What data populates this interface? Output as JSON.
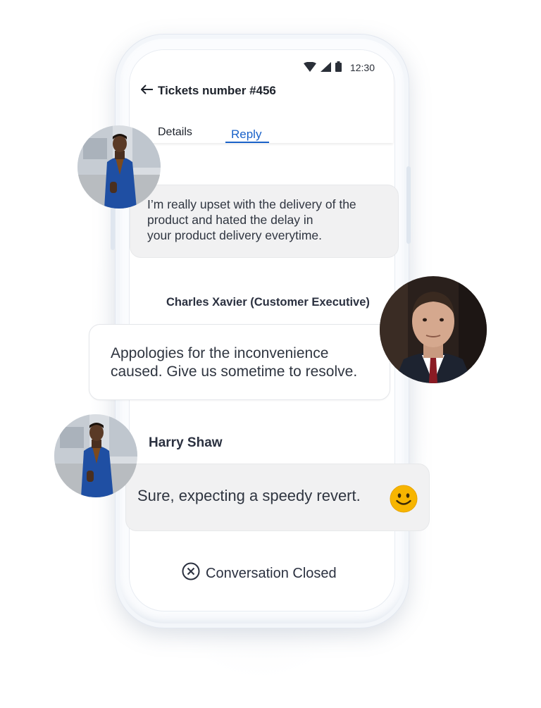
{
  "status_bar": {
    "time": "12:30",
    "wifi_icon": "wifi-icon",
    "signal_icon": "signal-icon",
    "battery_icon": "battery-icon"
  },
  "header": {
    "back_icon": "arrow-left-icon",
    "title": "Tickets number #456"
  },
  "tabs": [
    {
      "label": "Details",
      "active": false
    },
    {
      "label": "Reply",
      "active": true
    }
  ],
  "messages": [
    {
      "sender": "",
      "avatar_icon": "customer-avatar",
      "lines": [
        "I’m really upset with the delivery of the",
        "product and hated the delay in",
        "your product delivery everytime."
      ]
    },
    {
      "sender": "Charles Xavier (Customer Executive)",
      "avatar_icon": "executive-avatar",
      "lines": [
        "Appologies for the inconvenience",
        "caused. Give us sometime to resolve."
      ]
    },
    {
      "sender": "Harry Shaw",
      "avatar_icon": "customer-avatar",
      "lines": [
        "Sure, expecting a speedy revert."
      ],
      "emoji_icon": "smiley-face-icon"
    }
  ],
  "footer": {
    "status_icon": "close-circle-icon",
    "status_text": "Conversation Closed"
  },
  "colors": {
    "accent": "#1a62c9",
    "emoji_yellow": "#f7b500"
  }
}
